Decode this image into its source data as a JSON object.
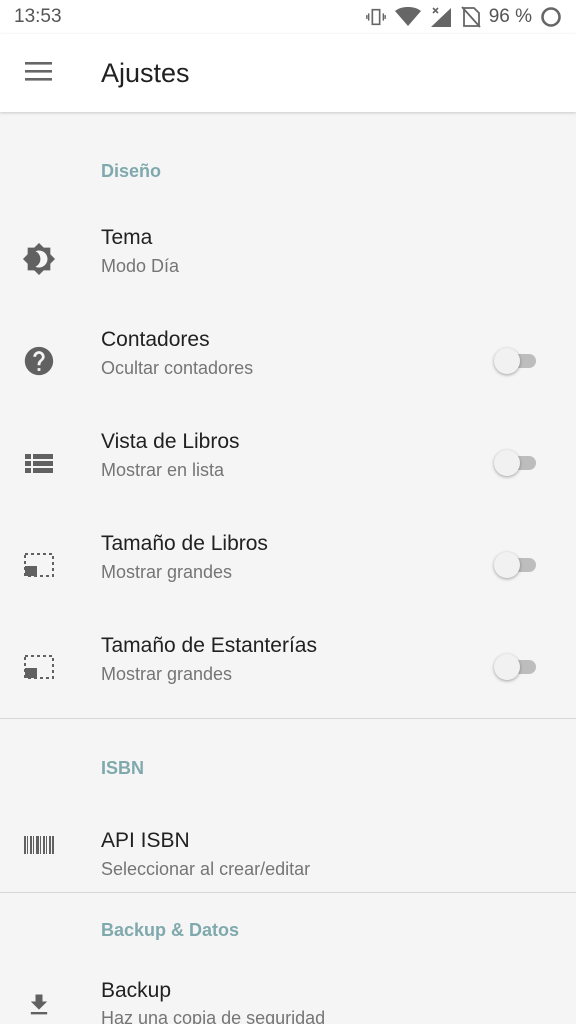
{
  "status_bar": {
    "time": "13:53",
    "battery": "96 %",
    "icons": [
      "vibrate-icon",
      "wifi-icon",
      "signal-icon",
      "no-sim-icon",
      "battery-icon"
    ]
  },
  "app_bar": {
    "title": "Ajustes",
    "menu_icon": "menu-icon"
  },
  "sections": [
    {
      "header": "Diseño",
      "items": [
        {
          "title": "Tema",
          "summary": "Modo Día",
          "icon": "brightness-icon",
          "switch": false
        },
        {
          "title": "Contadores",
          "summary": "Ocultar contadores",
          "icon": "help-icon",
          "switch": true,
          "checked": false
        },
        {
          "title": "Vista de Libros",
          "summary": "Mostrar en lista",
          "icon": "list-icon",
          "switch": true,
          "checked": false
        },
        {
          "title": "Tamaño de Libros",
          "summary": "Mostrar grandes",
          "icon": "picture-in-picture-icon",
          "switch": true,
          "checked": false
        },
        {
          "title": "Tamaño de Estanterías",
          "summary": "Mostrar grandes",
          "icon": "picture-in-picture-icon",
          "switch": true,
          "checked": false
        }
      ]
    },
    {
      "header": "ISBN",
      "items": [
        {
          "title": "API ISBN",
          "summary": "Seleccionar al crear/editar",
          "icon": "barcode-icon",
          "switch": false
        }
      ]
    },
    {
      "header": "Backup & Datos",
      "items": [
        {
          "title": "Backup",
          "summary": "Haz una copia de seguridad",
          "icon": "download-icon",
          "switch": false
        }
      ]
    }
  ],
  "colors": {
    "accent_header": "#7fa9ad",
    "background": "#f5f5f5",
    "icon": "#616161"
  }
}
